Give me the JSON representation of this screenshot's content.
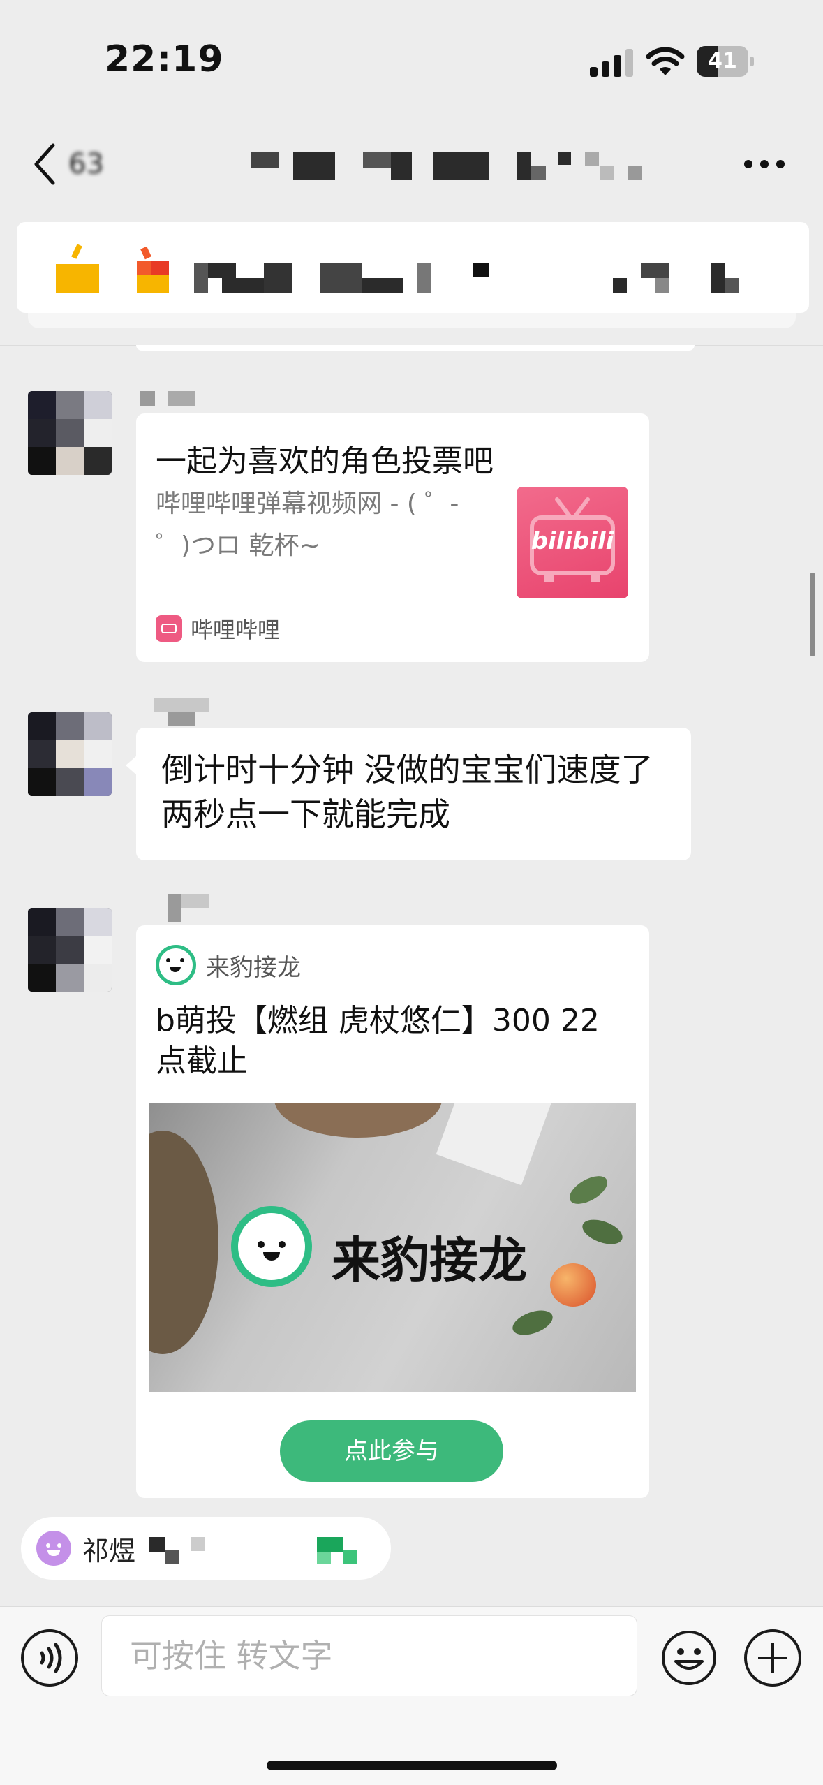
{
  "status_bar": {
    "time": "22:19",
    "battery": "41",
    "battery_level": 0.41
  },
  "nav": {
    "back_count": "63"
  },
  "messages": [
    {
      "type": "link",
      "title": "一起为喜欢的角色投票吧",
      "description": "哔哩哔哩弹幕视频网 - ( ゜- ゜)つロ  乾杯~",
      "thumb_text": "bilibili",
      "source": "哔哩哔哩"
    },
    {
      "type": "text",
      "text": "倒计时十分钟 没做的宝宝们速度了 两秒点一下就能完成"
    },
    {
      "type": "mini_program",
      "app_name": "来豹接龙",
      "title": "b萌投【燃组 虎杖悠仁】300 22点截止",
      "image_text": "来豹接龙",
      "button": "点此参与"
    }
  ],
  "mention": {
    "name": "祁煜"
  },
  "input": {
    "placeholder": "可按住 转文字"
  },
  "icons": {
    "back": "chevron-left-icon",
    "more": "more-icon",
    "voice": "voice-icon",
    "emoji": "emoji-icon",
    "plus": "plus-icon"
  }
}
